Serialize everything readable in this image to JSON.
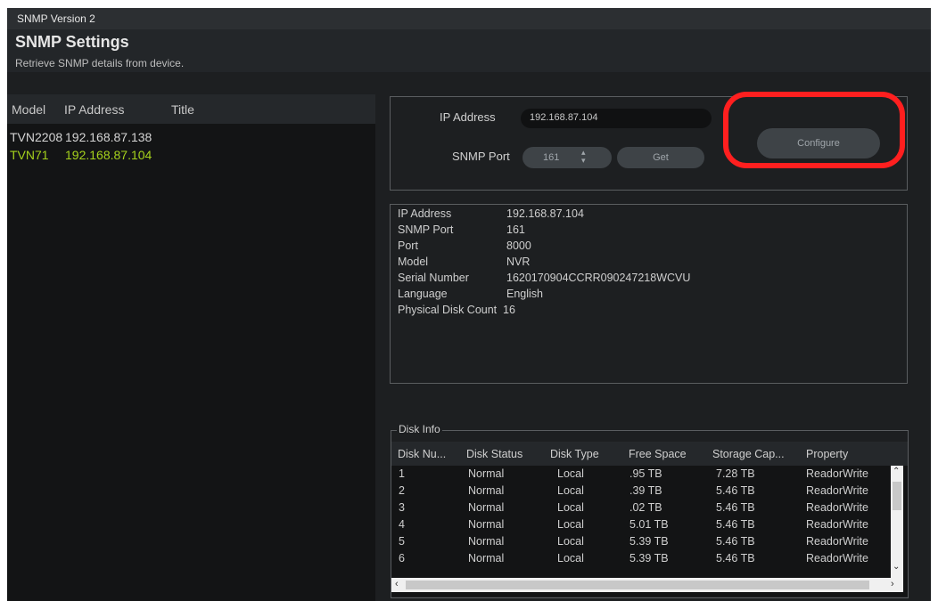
{
  "window": {
    "title": "SNMP Version 2"
  },
  "header": {
    "title": "SNMP Settings",
    "subtitle": "Retrieve SNMP details from device."
  },
  "device_list": {
    "columns": [
      "Model",
      "IP Address",
      "Title"
    ],
    "rows": [
      {
        "model": "TVN2208",
        "ip": "192.168.87.138",
        "title": "",
        "selected": false
      },
      {
        "model": "TVN71",
        "ip": "192.168.87.104",
        "title": "",
        "selected": true
      }
    ],
    "selected_color": "#a5d11c"
  },
  "query": {
    "ip_label": "IP Address",
    "ip_value": "192.168.87.104",
    "port_label": "SNMP Port",
    "port_value": "161",
    "get_label": "Get",
    "configure_label": "Configure"
  },
  "device_info": {
    "rows": [
      {
        "key": "IP Address",
        "value": "192.168.87.104"
      },
      {
        "key": "SNMP Port",
        "value": "161"
      },
      {
        "key": "Port",
        "value": "8000"
      },
      {
        "key": "Model",
        "value": "NVR"
      },
      {
        "key": "Serial Number",
        "value": "1620170904CCRR090247218WCVU"
      },
      {
        "key": "Language",
        "value": "English"
      },
      {
        "key": "Physical Disk Count",
        "value": "16"
      }
    ]
  },
  "disk_info": {
    "legend": "Disk Info",
    "columns": [
      "Disk Nu...",
      "Disk Status",
      "Disk Type",
      "Free Space",
      "Storage Cap...",
      "Property"
    ],
    "rows": [
      [
        "1",
        "Normal",
        "Local",
        ".95 TB",
        "7.28 TB",
        "ReadorWrite"
      ],
      [
        "2",
        "Normal",
        "Local",
        ".39 TB",
        "5.46 TB",
        "ReadorWrite"
      ],
      [
        "3",
        "Normal",
        "Local",
        ".02 TB",
        "5.46 TB",
        "ReadorWrite"
      ],
      [
        "4",
        "Normal",
        "Local",
        "5.01 TB",
        "5.46 TB",
        "ReadorWrite"
      ],
      [
        "5",
        "Normal",
        "Local",
        "5.39 TB",
        "5.46 TB",
        "ReadorWrite"
      ],
      [
        "6",
        "Normal",
        "Local",
        "5.39 TB",
        "5.46 TB",
        "ReadorWrite"
      ]
    ]
  },
  "icons": {
    "spinner": "up-down-arrows-icon",
    "scroll_up": "chevron-up-icon",
    "scroll_down": "chevron-down-icon",
    "scroll_left": "chevron-left-icon",
    "scroll_right": "chevron-right-icon"
  },
  "colors": {
    "highlight": "#ff1f1f",
    "background": "#1d1f21"
  }
}
